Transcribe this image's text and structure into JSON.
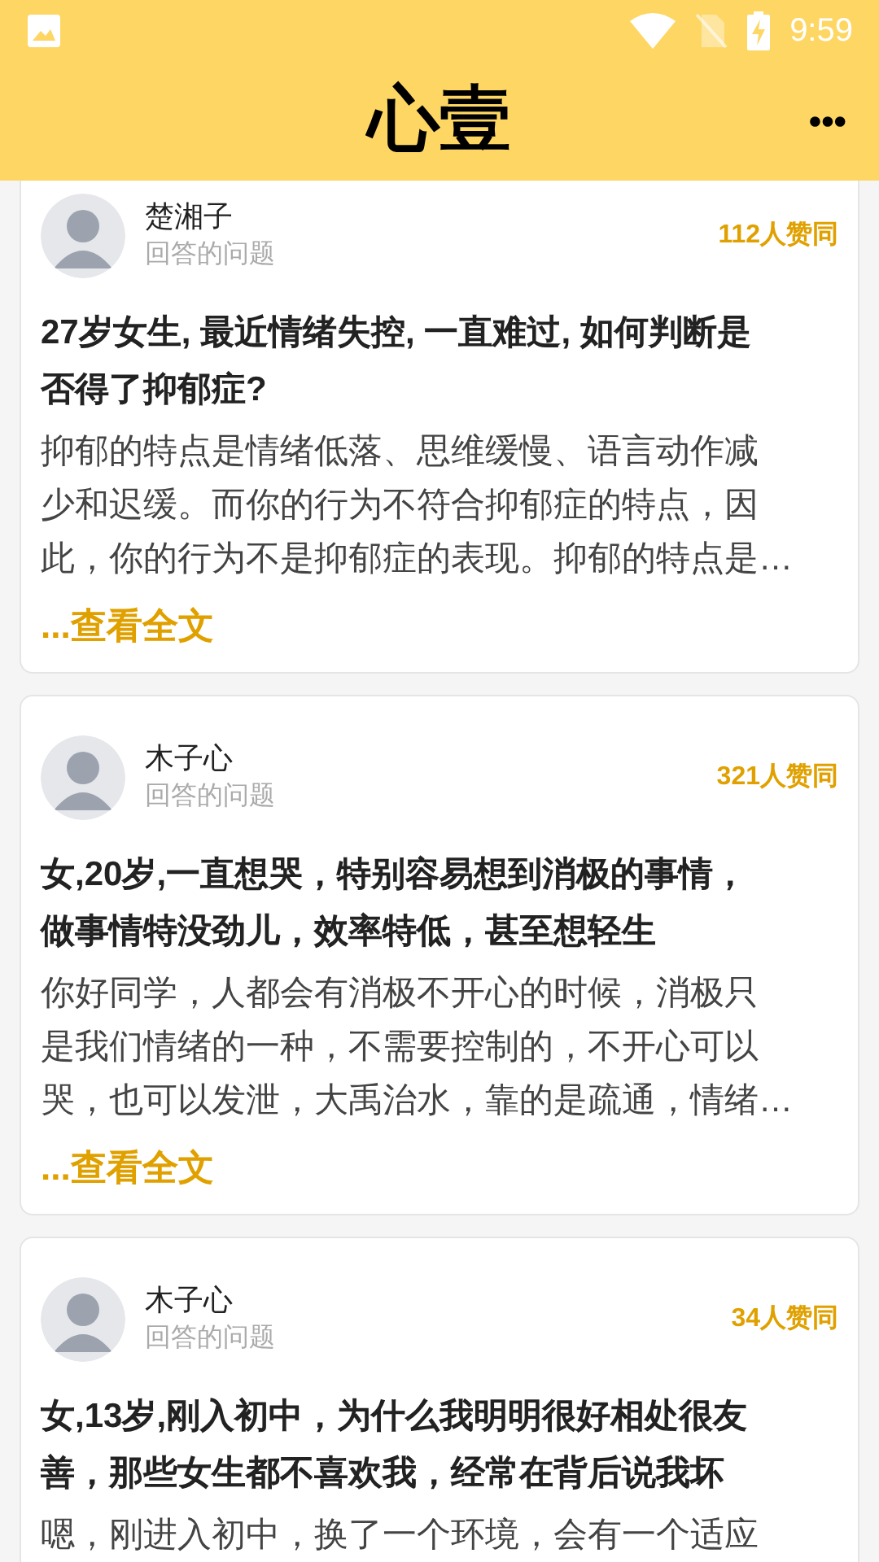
{
  "status_bar": {
    "time": "9:59"
  },
  "header": {
    "title": "心壹",
    "menu": "•••"
  },
  "answers": [
    {
      "author": "楚湘子",
      "subtitle": "回答的问题",
      "likes": "112人赞同",
      "title_lines": [
        "27岁女生, 最近情绪失控, 一直难过, 如何判断是",
        "否得了抑郁症?"
      ],
      "body_lines": [
        "抑郁的特点是情绪低落、思维缓慢、语言动作减",
        "少和迟缓。而你的行为不符合抑郁症的特点，因",
        "此，你的行为不是抑郁症的表现。抑郁的特点是…"
      ],
      "more": "...查看全文"
    },
    {
      "author": "木子心",
      "subtitle": "回答的问题",
      "likes": "321人赞同",
      "title_lines": [
        "女,20岁,一直想哭，特别容易想到消极的事情，",
        "做事情特没劲儿，效率特低，甚至想轻生"
      ],
      "body_lines": [
        "你好同学，人都会有消极不开心的时候，消极只",
        "是我们情绪的一种，不需要控制的，不开心可以",
        "哭，也可以发泄，大禹治水，靠的是疏通，情绪…"
      ],
      "more": "...查看全文"
    },
    {
      "author": "木子心",
      "subtitle": "回答的问题",
      "likes": "34人赞同",
      "title_lines": [
        "女,13岁,刚入初中，为什么我明明很好相处很友",
        "善，那些女生都不喜欢我，经常在背后说我坏"
      ],
      "body_lines": [
        "嗯，刚进入初中，换了一个环境，会有一个适应"
      ]
    }
  ]
}
